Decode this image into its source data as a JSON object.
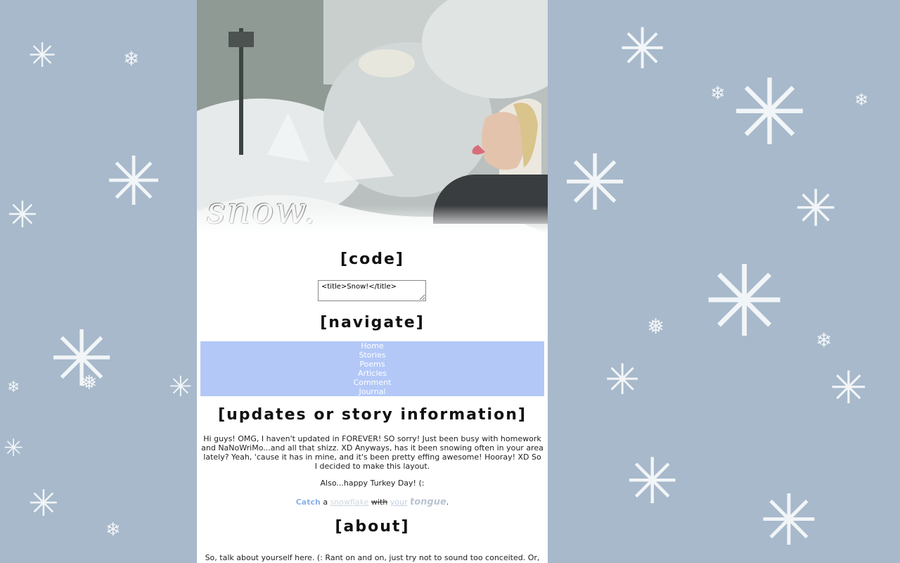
{
  "header": {
    "logo_text": "snow."
  },
  "code_section": {
    "title": "[code]",
    "textarea_value": "<title>Snow!</title>"
  },
  "navigate_section": {
    "title": "[navigate]",
    "links": [
      "Home",
      "Stories",
      "Poems",
      "Articles",
      "Comment",
      "Journal"
    ]
  },
  "updates_section": {
    "title": "[updates or story information]",
    "paragraph": "Hi guys! OMG, I haven't updated in FOREVER! SO sorry! Just been busy with homework and NaNoWriMo...and all that shizz. XD Anyways, has it been snowing often in your area lately? Yeah, 'cause it has in mine, and it's been pretty effing awesome! Hooray! XD So I decided to make this layout.",
    "turkey_line": "Also...happy Turkey Day! (:",
    "catch_line": {
      "w1": "Catch",
      "w2": " a ",
      "w3": "snowflake",
      "w4": "with",
      "w5": "your",
      "w6": "tongue",
      "w7": "."
    }
  },
  "about_section": {
    "title": "[about]",
    "paragraph": "So, talk about yourself here. (: Rant on and on, just try not to sound too conceited. Or, you"
  },
  "colors": {
    "background": "#a7b9cb",
    "nav_background": "#b3c8f7",
    "catch_accent": "#8ab0e8"
  },
  "icons": {
    "background": "snowflake-icon"
  }
}
